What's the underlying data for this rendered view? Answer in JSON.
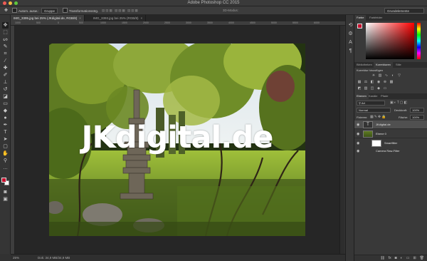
{
  "window": {
    "title": "Adobe Photoshop CC 2015"
  },
  "options_bar": {
    "auto_select_label": "Autom. ausw.:",
    "auto_select_value": "Gruppe",
    "transform_controls_label": "Transformationsstrg.",
    "mode_3d_label": "3D-Modus:",
    "workspace_value": "Grundelemente"
  },
  "tabs": [
    {
      "label": "IMG_3395.jpg bei 25% (JKdigital.de, RGB/8)",
      "close": "×"
    },
    {
      "label": "IMG_3393.jpg bei 25% (RGB/8)",
      "close": "×"
    }
  ],
  "rulers": {
    "top_ticks": [
      "1000",
      "500",
      "0",
      "500",
      "1000",
      "1500",
      "2000",
      "2500",
      "3000",
      "3500",
      "4000",
      "4500",
      "5000",
      "5500",
      "6000"
    ]
  },
  "canvas": {
    "watermark_text": "JKdigital.de"
  },
  "status_bar": {
    "zoom": "25%",
    "doc_info": "Dok: 34,9 MB/34,9 MB"
  },
  "panels": {
    "color_tabs": [
      "Farbe",
      "Farbfelder"
    ],
    "library_tabs": [
      "Bibliotheken",
      "Korrekturen",
      "Stile"
    ],
    "add_adjustment_label": "Korrektur hinzufügen",
    "layer_tabs": [
      "Ebenen",
      "Kanäle",
      "Pfade"
    ],
    "filter_kind": "Art",
    "blend_mode": "Normal",
    "opacity_label": "Deckkraft:",
    "opacity_value": "100%",
    "lock_label": "Fixieren:",
    "fill_label": "Fläche:",
    "fill_value": "100%",
    "layers": [
      {
        "name": "JKdigital.de",
        "thumb": "T",
        "selected": true
      },
      {
        "name": "Ebene 0",
        "thumb": "",
        "selected": false
      },
      {
        "name": "Smartfilter",
        "thumb": "",
        "selected": false
      },
      {
        "name": "Camera Raw-Filter",
        "thumb": "",
        "selected": false
      }
    ],
    "footer_icons": [
      "link-icon",
      "fx-icon",
      "mask-icon",
      "adjustment-icon",
      "folder-icon",
      "new-layer-icon",
      "trash-icon"
    ]
  },
  "colors": {
    "foreground": "#c8102e",
    "background": "#ffffff"
  }
}
